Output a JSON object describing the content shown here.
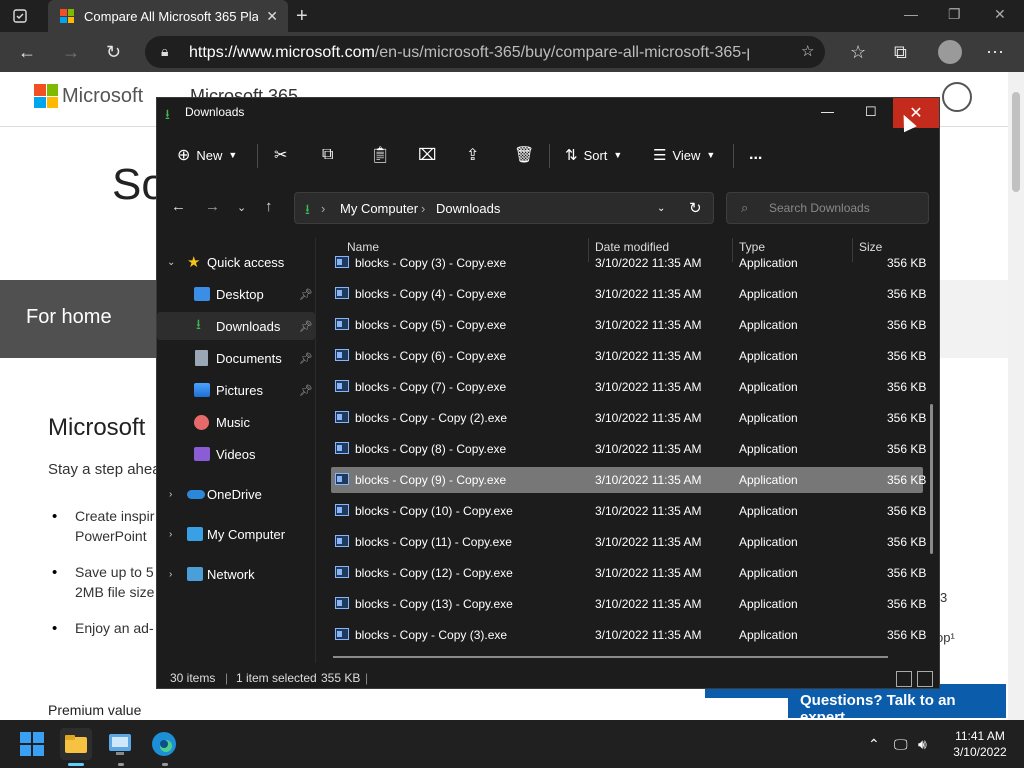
{
  "browser": {
    "tab_title": "Compare All Microsoft 365 Plans",
    "url_host": "https://www.microsoft.com",
    "url_path": "/en-us/microsoft-365/buy/compare-all-microsoft-365-p..."
  },
  "page": {
    "brand": "Microsoft",
    "product": "Microsoft 365",
    "heading_fragment": "So",
    "for_home": "For home",
    "section_title": "Microsoft",
    "intro": "Stay a step ahea",
    "bullets": [
      "Create inspir",
      "PowerPoint",
      "Save up to 5",
      "2MB file size",
      "Enjoy an ad-"
    ],
    "right_fragments": [
      "3",
      "op¹"
    ],
    "premium_value": "Premium value",
    "chat_button": "Questions? Talk to an expert"
  },
  "explorer": {
    "window_title": "Downloads",
    "toolbar": {
      "new": "New",
      "sort": "Sort",
      "view": "View",
      "more": "..."
    },
    "breadcrumb": [
      "My Computer",
      "Downloads"
    ],
    "search_placeholder": "Search Downloads",
    "sidebar": [
      {
        "label": "Quick access",
        "icon": "star-icon"
      },
      {
        "label": "Desktop",
        "icon": "desktop-icon"
      },
      {
        "label": "Downloads",
        "icon": "download-icon"
      },
      {
        "label": "Documents",
        "icon": "documents-icon"
      },
      {
        "label": "Pictures",
        "icon": "pictures-icon"
      },
      {
        "label": "Music",
        "icon": "music-icon"
      },
      {
        "label": "Videos",
        "icon": "videos-icon"
      },
      {
        "label": "OneDrive",
        "icon": "cloud-icon"
      },
      {
        "label": "My Computer",
        "icon": "computer-icon"
      },
      {
        "label": "Network",
        "icon": "network-icon"
      }
    ],
    "columns": {
      "name": "Name",
      "date": "Date modified",
      "type": "Type",
      "size": "Size"
    },
    "files": [
      {
        "name": "blocks - Copy (3) - Copy.exe",
        "date": "3/10/2022 11:35 AM",
        "type": "Application",
        "size": "356 KB"
      },
      {
        "name": "blocks - Copy (4) - Copy.exe",
        "date": "3/10/2022 11:35 AM",
        "type": "Application",
        "size": "356 KB"
      },
      {
        "name": "blocks - Copy (5) - Copy.exe",
        "date": "3/10/2022 11:35 AM",
        "type": "Application",
        "size": "356 KB"
      },
      {
        "name": "blocks - Copy (6) - Copy.exe",
        "date": "3/10/2022 11:35 AM",
        "type": "Application",
        "size": "356 KB"
      },
      {
        "name": "blocks - Copy (7) - Copy.exe",
        "date": "3/10/2022 11:35 AM",
        "type": "Application",
        "size": "356 KB"
      },
      {
        "name": "blocks - Copy - Copy (2).exe",
        "date": "3/10/2022 11:35 AM",
        "type": "Application",
        "size": "356 KB"
      },
      {
        "name": "blocks - Copy (8) - Copy.exe",
        "date": "3/10/2022 11:35 AM",
        "type": "Application",
        "size": "356 KB"
      },
      {
        "name": "blocks - Copy (9) - Copy.exe",
        "date": "3/10/2022 11:35 AM",
        "type": "Application",
        "size": "356 KB"
      },
      {
        "name": "blocks - Copy (10) - Copy.exe",
        "date": "3/10/2022 11:35 AM",
        "type": "Application",
        "size": "356 KB"
      },
      {
        "name": "blocks - Copy (11) - Copy.exe",
        "date": "3/10/2022 11:35 AM",
        "type": "Application",
        "size": "356 KB"
      },
      {
        "name": "blocks - Copy (12) - Copy.exe",
        "date": "3/10/2022 11:35 AM",
        "type": "Application",
        "size": "356 KB"
      },
      {
        "name": "blocks - Copy (13) - Copy.exe",
        "date": "3/10/2022 11:35 AM",
        "type": "Application",
        "size": "356 KB"
      },
      {
        "name": "blocks - Copy - Copy (3).exe",
        "date": "3/10/2022 11:35 AM",
        "type": "Application",
        "size": "356 KB"
      }
    ],
    "selected_index": 7,
    "status": {
      "items": "30 items",
      "selected": "1 item selected",
      "size": "355 KB"
    }
  },
  "taskbar": {
    "time": "11:41 AM",
    "date": "3/10/2022"
  },
  "colors": {
    "close_red": "#c42b1c",
    "chat_blue": "#0b5cab",
    "explorer_bg": "#1c1c1c"
  }
}
